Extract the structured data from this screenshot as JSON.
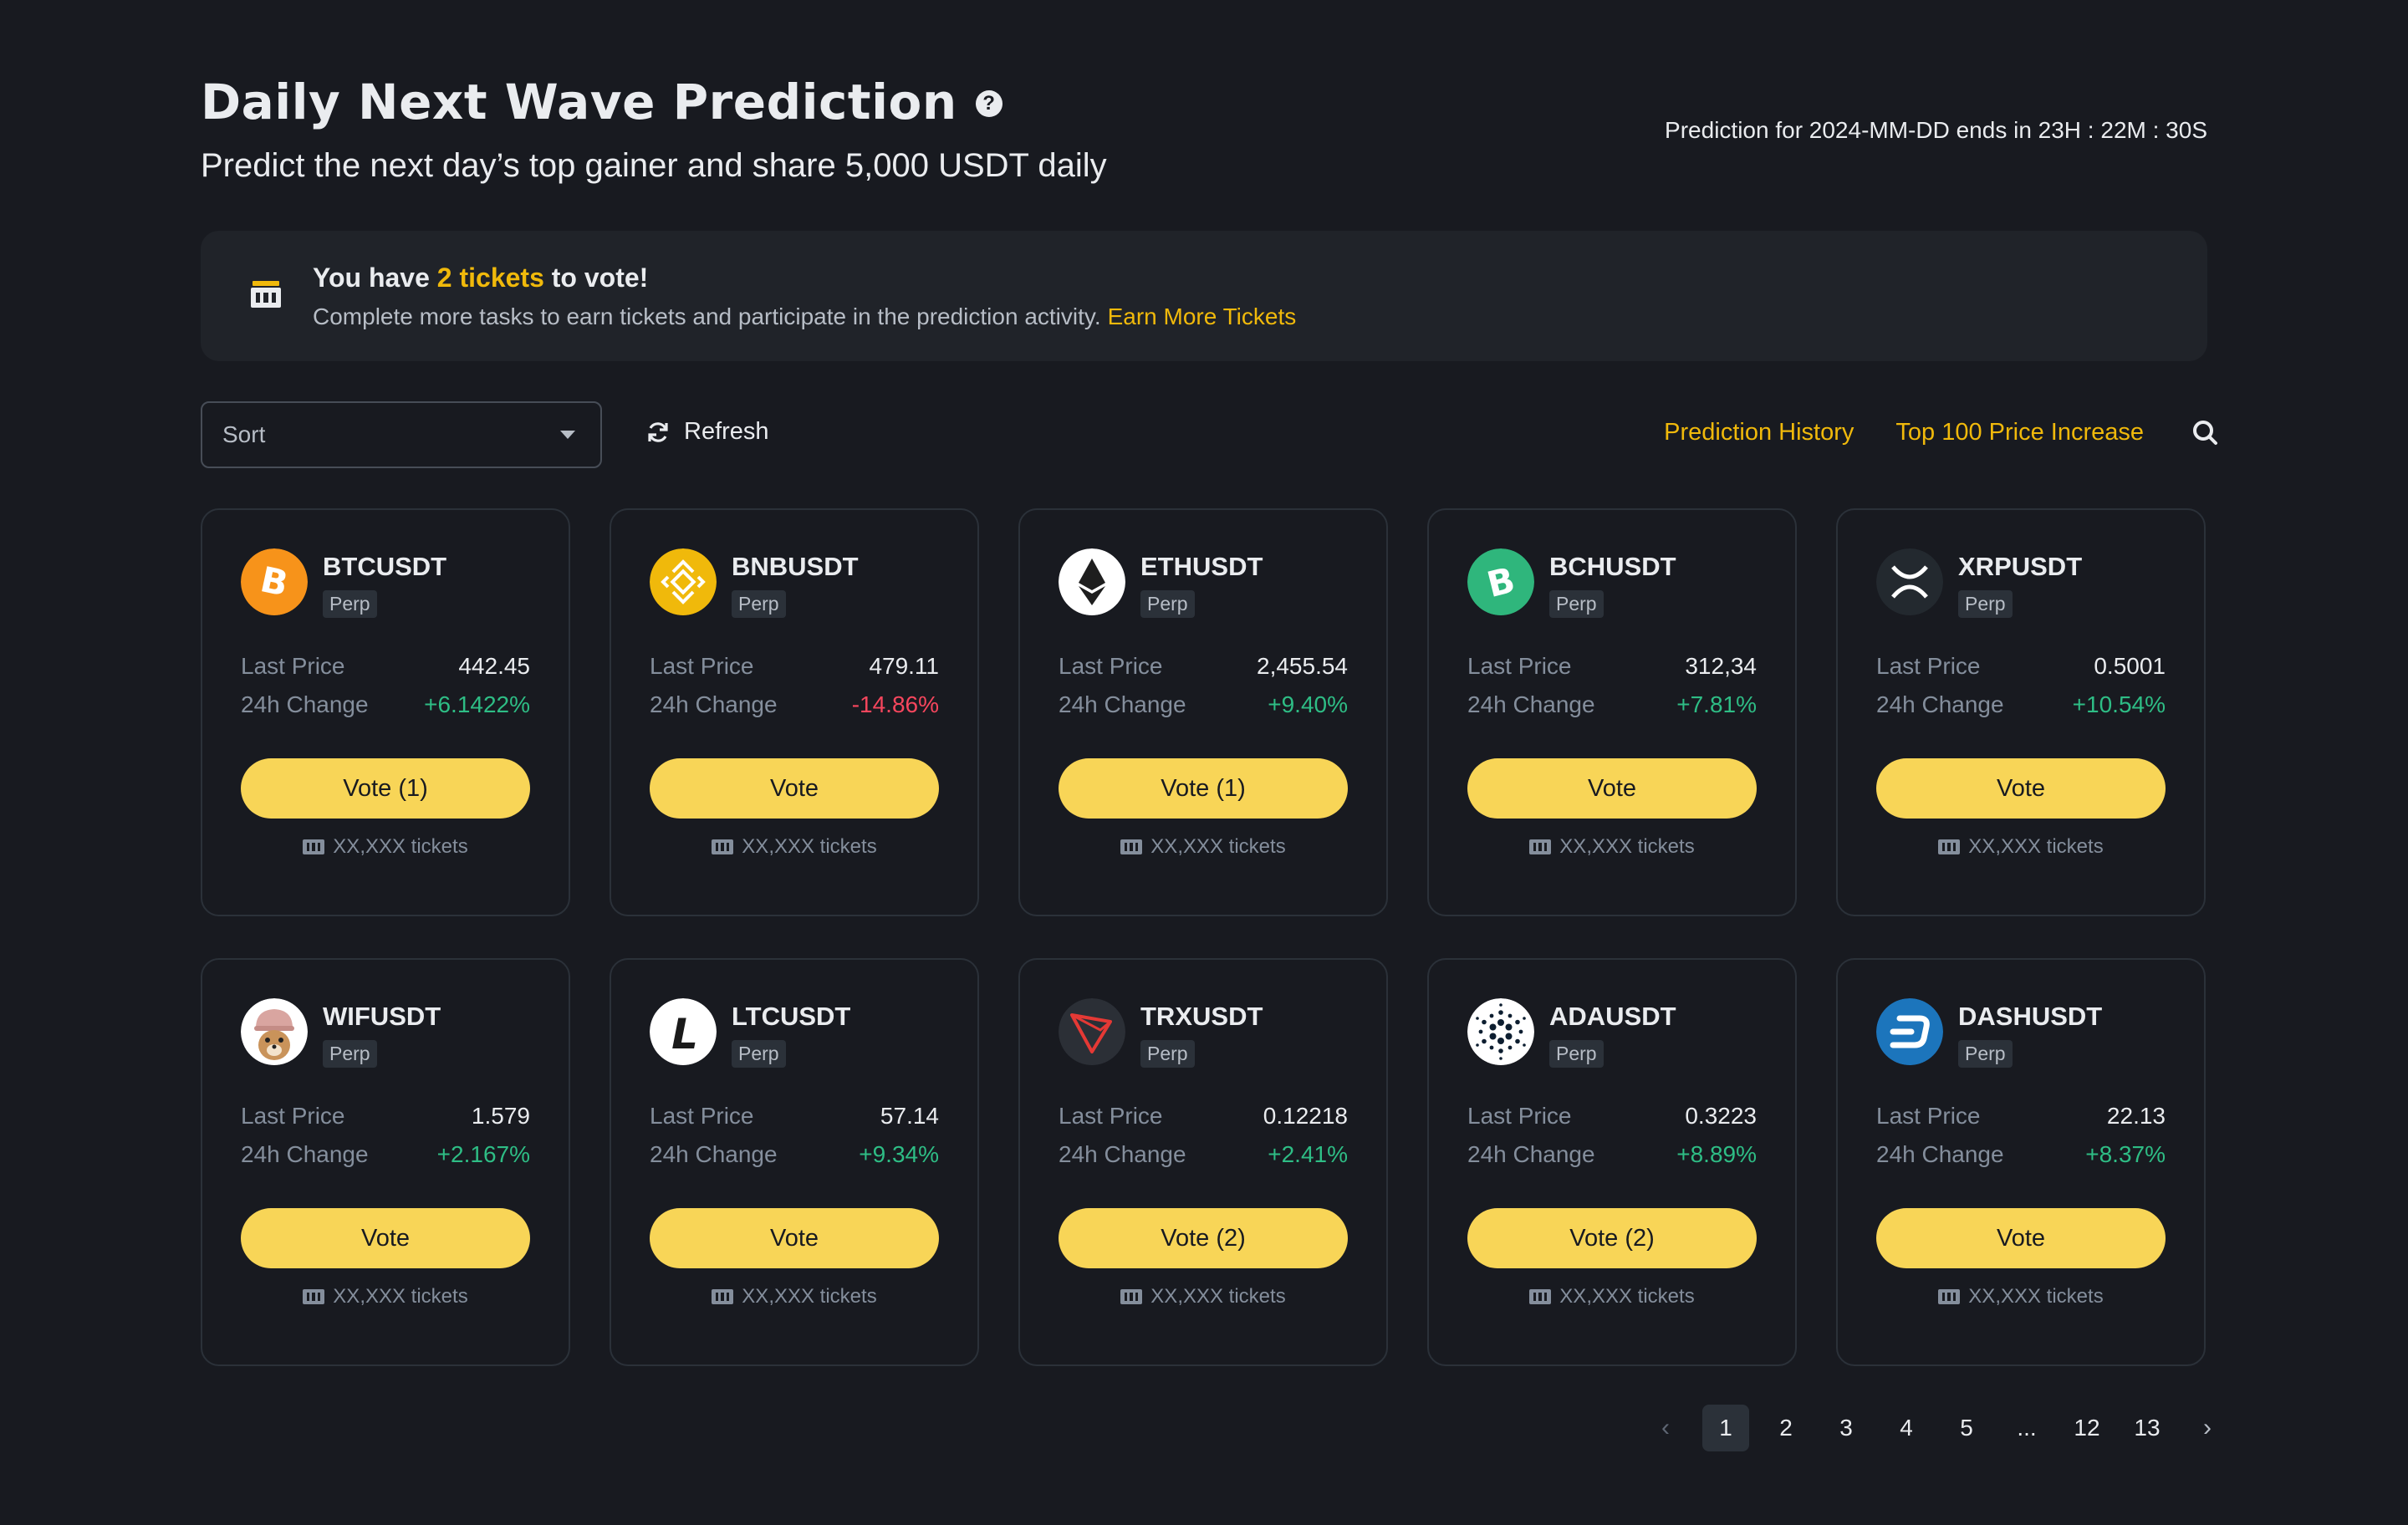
{
  "header": {
    "title": "Daily Next Wave Prediction",
    "help_glyph": "?",
    "subtitle": "Predict the next day’s top gainer and share 5,000 USDT daily",
    "countdown": "Prediction for 2024-MM-DD ends in 23H : 22M : 30S"
  },
  "banner": {
    "prefix": "You have ",
    "highlight": "2 tickets",
    "suffix": " to vote!",
    "sub": "Complete more tasks to earn tickets and participate in the prediction activity.",
    "link": "Earn More Tickets"
  },
  "toolbar": {
    "sort_placeholder": "Sort",
    "refresh_label": "Refresh",
    "history_link": "Prediction History",
    "top100_link": "Top 100 Price Increase"
  },
  "labels": {
    "perp": "Perp",
    "last_price": "Last Price",
    "change_24h": "24h Change",
    "tickets": "XX,XXX tickets"
  },
  "coins": [
    {
      "symbol": "BTCUSDT",
      "price": "442.45",
      "change": "+6.1422%",
      "direction": "up",
      "vote": "Vote (1)",
      "icon": "bitcoin-icon",
      "color": "#f7931a"
    },
    {
      "symbol": "BNBUSDT",
      "price": "479.11",
      "change": "-14.86%",
      "direction": "down",
      "vote": "Vote",
      "icon": "bnb-icon",
      "color": "#f0b90b"
    },
    {
      "symbol": "ETHUSDT",
      "price": "2,455.54",
      "change": "+9.40%",
      "direction": "up",
      "vote": "Vote (1)",
      "icon": "ethereum-icon",
      "color": "#ffffff"
    },
    {
      "symbol": "BCHUSDT",
      "price": "312,34",
      "change": "+7.81%",
      "direction": "up",
      "vote": "Vote",
      "icon": "bitcoin-cash-icon",
      "color": "#2fb67c"
    },
    {
      "symbol": "XRPUSDT",
      "price": "0.5001",
      "change": "+10.54%",
      "direction": "up",
      "vote": "Vote",
      "icon": "xrp-icon",
      "color": "#23292f"
    },
    {
      "symbol": "WIFUSDT",
      "price": "1.579",
      "change": "+2.167%",
      "direction": "up",
      "vote": "Vote",
      "icon": "dogwifhat-icon",
      "color": "#c9a27a"
    },
    {
      "symbol": "LTCUSDT",
      "price": "57.14",
      "change": "+9.34%",
      "direction": "up",
      "vote": "Vote",
      "icon": "litecoin-icon",
      "color": "#ffffff"
    },
    {
      "symbol": "TRXUSDT",
      "price": "0.12218",
      "change": "+2.41%",
      "direction": "up",
      "vote": "Vote (2)",
      "icon": "tron-icon",
      "color": "#2b2f36"
    },
    {
      "symbol": "ADAUSDT",
      "price": "0.3223",
      "change": "+8.89%",
      "direction": "up",
      "vote": "Vote (2)",
      "icon": "cardano-icon",
      "color": "#ffffff"
    },
    {
      "symbol": "DASHUSDT",
      "price": "22.13",
      "change": "+8.37%",
      "direction": "up",
      "vote": "Vote",
      "icon": "dash-icon",
      "color": "#1c75bc"
    }
  ],
  "pagination": {
    "prev": "‹",
    "pages": [
      "1",
      "2",
      "3",
      "4",
      "5",
      "...",
      "12",
      "13"
    ],
    "active": "1",
    "next": "›"
  },
  "colors": {
    "background": "#181a20",
    "accent": "#f0b90b",
    "button": "#f8d557",
    "up": "#2ebd85",
    "down": "#f6465d"
  }
}
